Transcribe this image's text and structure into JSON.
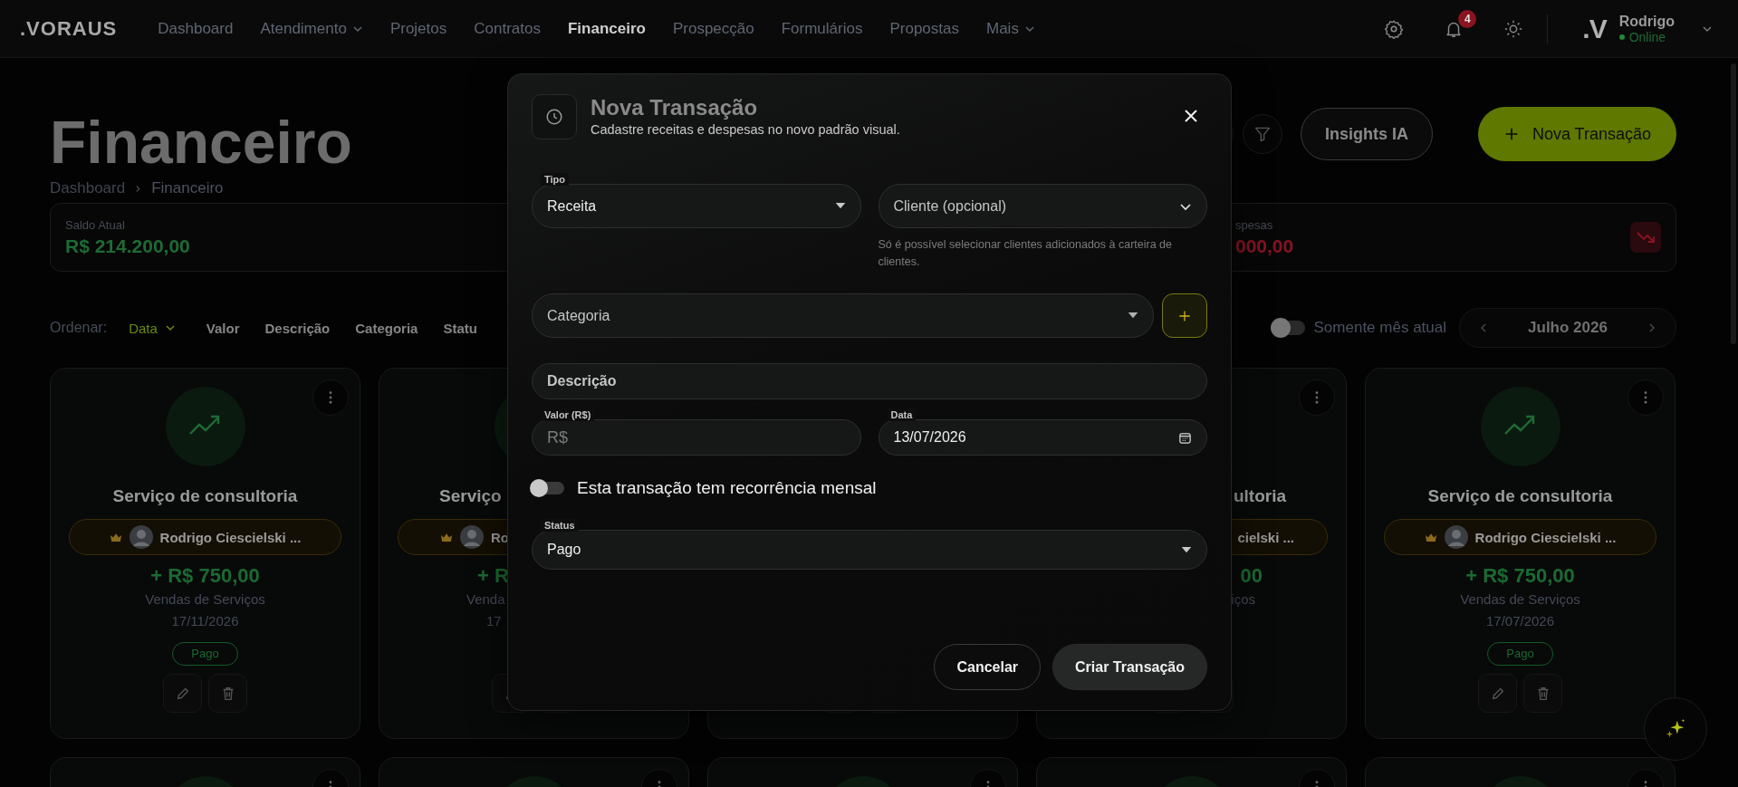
{
  "nav": {
    "logo": ".VORAUS",
    "items": [
      {
        "label": "Dashboard",
        "selected": false,
        "has_menu": false
      },
      {
        "label": "Atendimento",
        "selected": false,
        "has_menu": true
      },
      {
        "label": "Projetos",
        "selected": false,
        "has_menu": false
      },
      {
        "label": "Contratos",
        "selected": false,
        "has_menu": false
      },
      {
        "label": "Financeiro",
        "selected": true,
        "has_menu": false
      },
      {
        "label": "Prospecção",
        "selected": false,
        "has_menu": false
      },
      {
        "label": "Formulários",
        "selected": false,
        "has_menu": false
      },
      {
        "label": "Propostas",
        "selected": false,
        "has_menu": false
      },
      {
        "label": "Mais",
        "selected": false,
        "has_menu": true
      }
    ],
    "notifications": "4",
    "user": {
      "logo": ".V",
      "name": "Rodrigo",
      "status": "Online"
    }
  },
  "header": {
    "title": "Financeiro",
    "breadcrumb": [
      "Dashboard",
      "Financeiro"
    ],
    "insights": "Insights IA",
    "new_transaction": "Nova Transação"
  },
  "stats": [
    {
      "label": "Saldo Atual",
      "value": "R$ 214.200,00",
      "kind": "income"
    },
    {
      "label": "spesas",
      "value": "000,00",
      "kind": "expense"
    }
  ],
  "sort": {
    "label": "Ordenar:",
    "options": [
      {
        "label": "Data",
        "selected": true
      },
      {
        "label": "Valor",
        "selected": false
      },
      {
        "label": "Descrição",
        "selected": false
      },
      {
        "label": "Categoria",
        "selected": false
      },
      {
        "label": "Statu",
        "selected": false
      }
    ]
  },
  "month_filter": {
    "label": "Somente mês atual",
    "on": false
  },
  "month": "Julho 2026",
  "cards": [
    {
      "title": "Serviço de consultoria",
      "client": "Rodrigo Ciescielski ...",
      "amount": "+ R$ 750,00",
      "category": "Vendas de Serviços",
      "date": "17/11/2026",
      "status": "Pago"
    },
    {
      "title": "Serviço",
      "client": "Ro",
      "amount": "+ R",
      "category": "Venda",
      "date": "17"
    },
    {
      "title": "ultoria",
      "client": "cielski ...",
      "amount": "00",
      "category": "iços"
    },
    {
      "title": "Serviço de consultoria",
      "client": "Rodrigo Ciescielski ...",
      "amount": "+ R$ 750,00",
      "category": "Vendas de Serviços",
      "date": "17/07/2026",
      "status": "Pago"
    }
  ],
  "modal": {
    "title": "Nova Transação",
    "subtitle": "Cadastre receitas e despesas no novo padrão visual.",
    "tipo": {
      "label": "Tipo",
      "value": "Receita"
    },
    "cliente": {
      "placeholder": "Cliente (opcional)",
      "hint": "Só é possível selecionar clientes adicionados à carteira de clientes."
    },
    "categoria": {
      "placeholder": "Categoria"
    },
    "descricao": {
      "placeholder": "Descrição"
    },
    "valor": {
      "label": "Valor (R$)",
      "placeholder": "R$"
    },
    "data": {
      "label": "Data",
      "value": "13/07/2026"
    },
    "recorrencia": {
      "label": "Esta transação tem recorrência mensal",
      "on": false
    },
    "status": {
      "label": "Status",
      "value": "Pago"
    },
    "cancel": "Cancelar",
    "submit": "Criar Transação"
  }
}
